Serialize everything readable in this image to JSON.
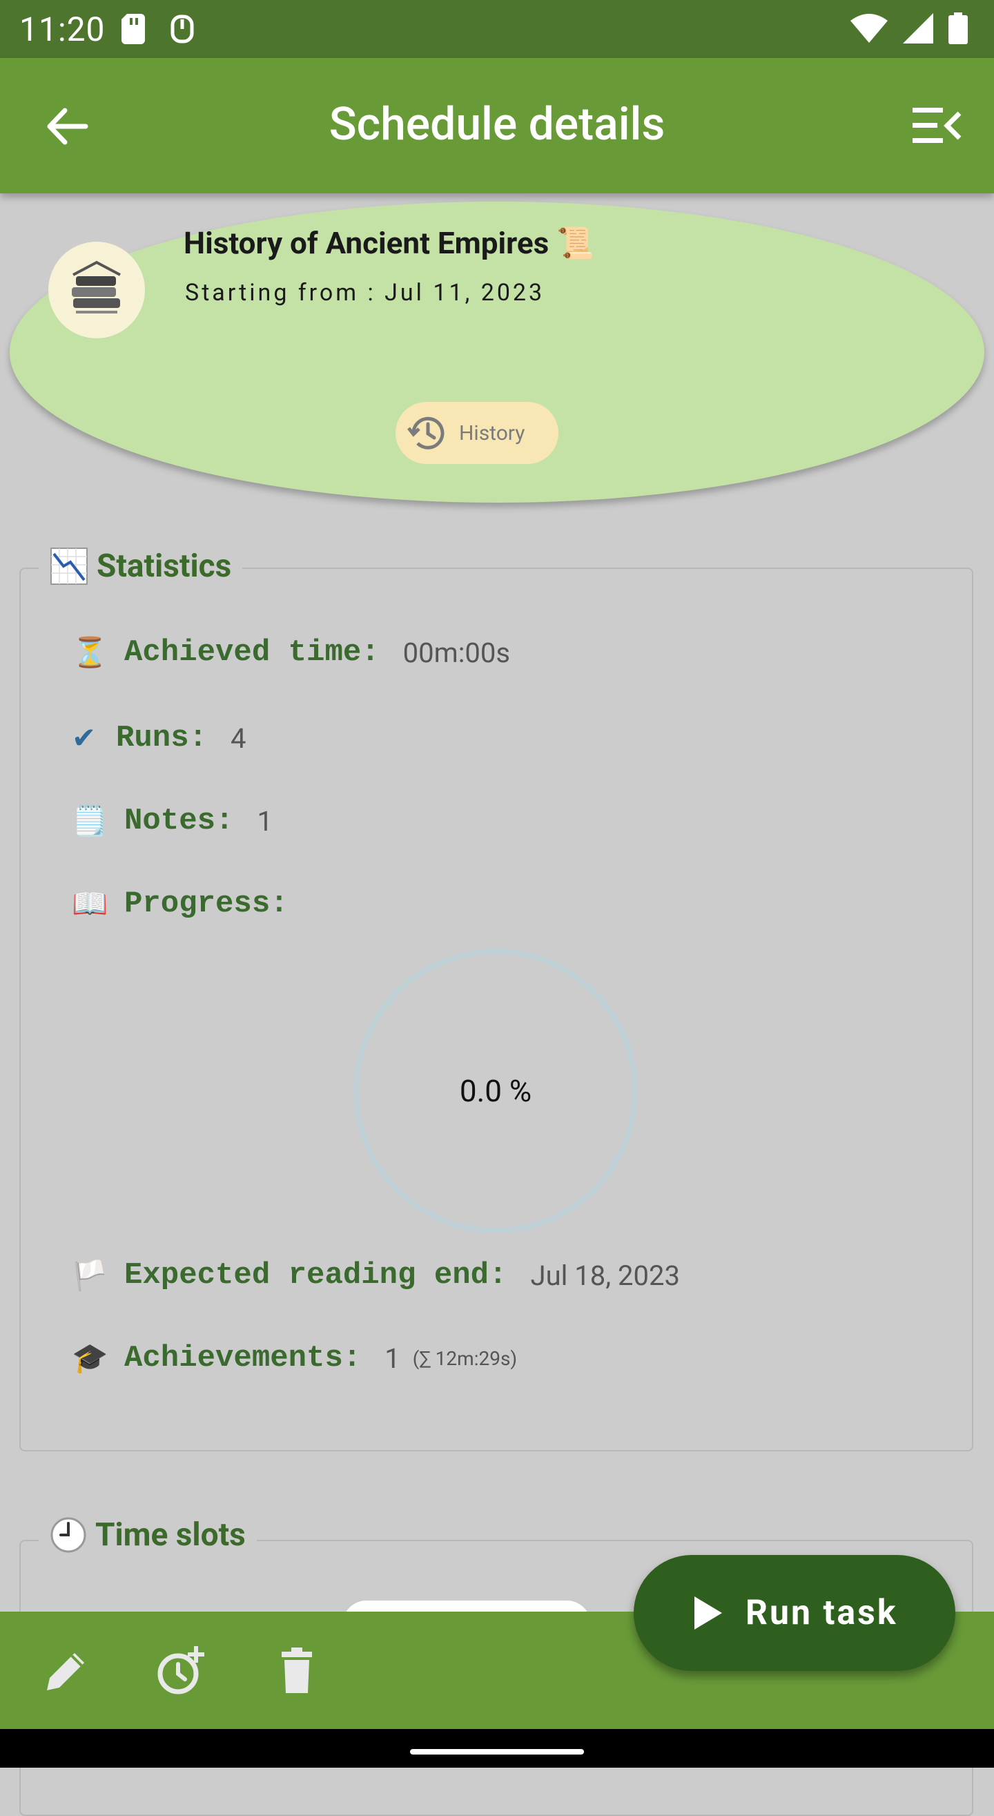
{
  "status": {
    "time": "11:20"
  },
  "appbar": {
    "title": "Schedule details"
  },
  "header": {
    "course_title": "History of Ancient Empires 📜",
    "start_date": "Starting from : Jul 11, 2023",
    "history_chip": "History"
  },
  "statistics": {
    "section_title": "Statistics",
    "achieved_time": {
      "icon": "⏳",
      "label": "Achieved time:",
      "value": "00m:00s"
    },
    "runs": {
      "icon": "✔",
      "label": "Runs:",
      "value": "4"
    },
    "notes": {
      "icon": "🗒️",
      "label": "Notes:",
      "value": "1"
    },
    "progress": {
      "icon": "📖",
      "label": "Progress:",
      "value": "0.0 %",
      "fraction": 0.0
    },
    "expected_end": {
      "icon": "🏳️",
      "label": "Expected reading end:",
      "value": "Jul 18, 2023"
    },
    "achievements": {
      "icon": "🎓",
      "label": "Achievements:",
      "value": "1",
      "sub": "(∑ 12m:29s)"
    }
  },
  "time_slots": {
    "section_title": "Time slots"
  },
  "fab": {
    "label": "Run task"
  },
  "colors": {
    "appbar": "#689b38",
    "statusbar": "#4e752e",
    "fab": "#2f5f1f",
    "card": "#c4e1a6",
    "label_green": "#3a6a2e"
  }
}
